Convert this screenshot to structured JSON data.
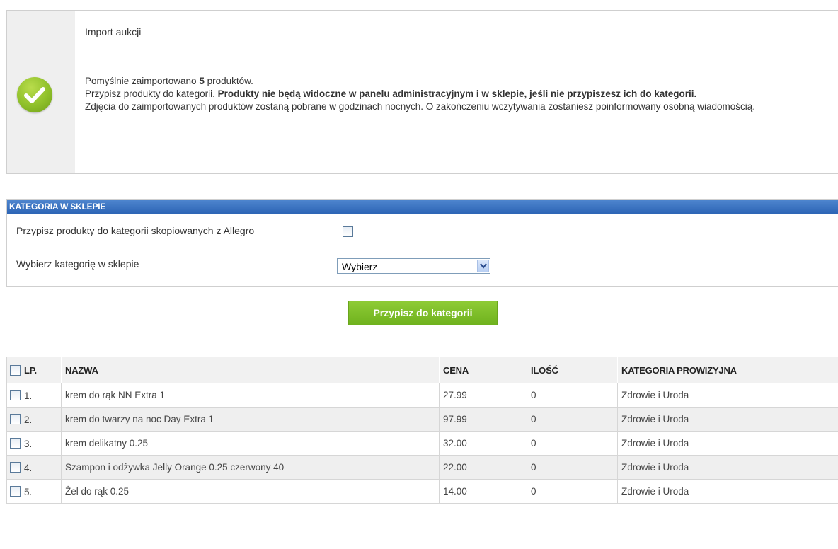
{
  "notice": {
    "title": "Import aukcji",
    "line1_pre": "Pomyślnie zaimportowano ",
    "line1_count": "5",
    "line1_post": " produktów.",
    "line2_pre": "Przypisz produkty do kategorii. ",
    "line2_bold": "Produkty nie będą widoczne w panelu administracyjnym i w sklepie, jeśli nie przypiszesz ich do kategorii.",
    "line3": "Zdjęcia do zaimportowanych produktów zostaną pobrane w godzinach nocnych. O zakończeniu wczytywania zostaniesz poinformowany osobną wiadomością."
  },
  "category_panel": {
    "header": "KATEGORIA W SKLEPIE",
    "copy_label": "Przypisz produkty do kategorii skopiowanych z Allegro",
    "select_label": "Wybierz kategorię w sklepie",
    "select_value": "Wybierz"
  },
  "assign_button": "Przypisz do kategorii",
  "table": {
    "headers": {
      "lp": "LP.",
      "name": "NAZWA",
      "price": "CENA",
      "qty": "ILOŚĆ",
      "category": "KATEGORIA PROWIZYJNA"
    },
    "rows": [
      {
        "lp": "1.",
        "name": "krem do rąk NN Extra 1",
        "price": "27.99",
        "qty": "0",
        "category": "Zdrowie i Uroda"
      },
      {
        "lp": "2.",
        "name": "krem do twarzy na noc Day Extra 1",
        "price": "97.99",
        "qty": "0",
        "category": "Zdrowie i Uroda"
      },
      {
        "lp": "3.",
        "name": "krem delikatny 0.25",
        "price": "32.00",
        "qty": "0",
        "category": "Zdrowie i Uroda"
      },
      {
        "lp": "4.",
        "name": "Szampon i odżywka Jelly Orange 0.25 czerwony 40",
        "price": "22.00",
        "qty": "0",
        "category": "Zdrowie i Uroda"
      },
      {
        "lp": "5.",
        "name": "Żel do rąk 0.25",
        "price": "14.00",
        "qty": "0",
        "category": "Zdrowie i Uroda"
      }
    ]
  },
  "colors": {
    "header_blue": "#2b63b4",
    "button_green": "#7dbd27",
    "success_green": "#8fc02a"
  }
}
